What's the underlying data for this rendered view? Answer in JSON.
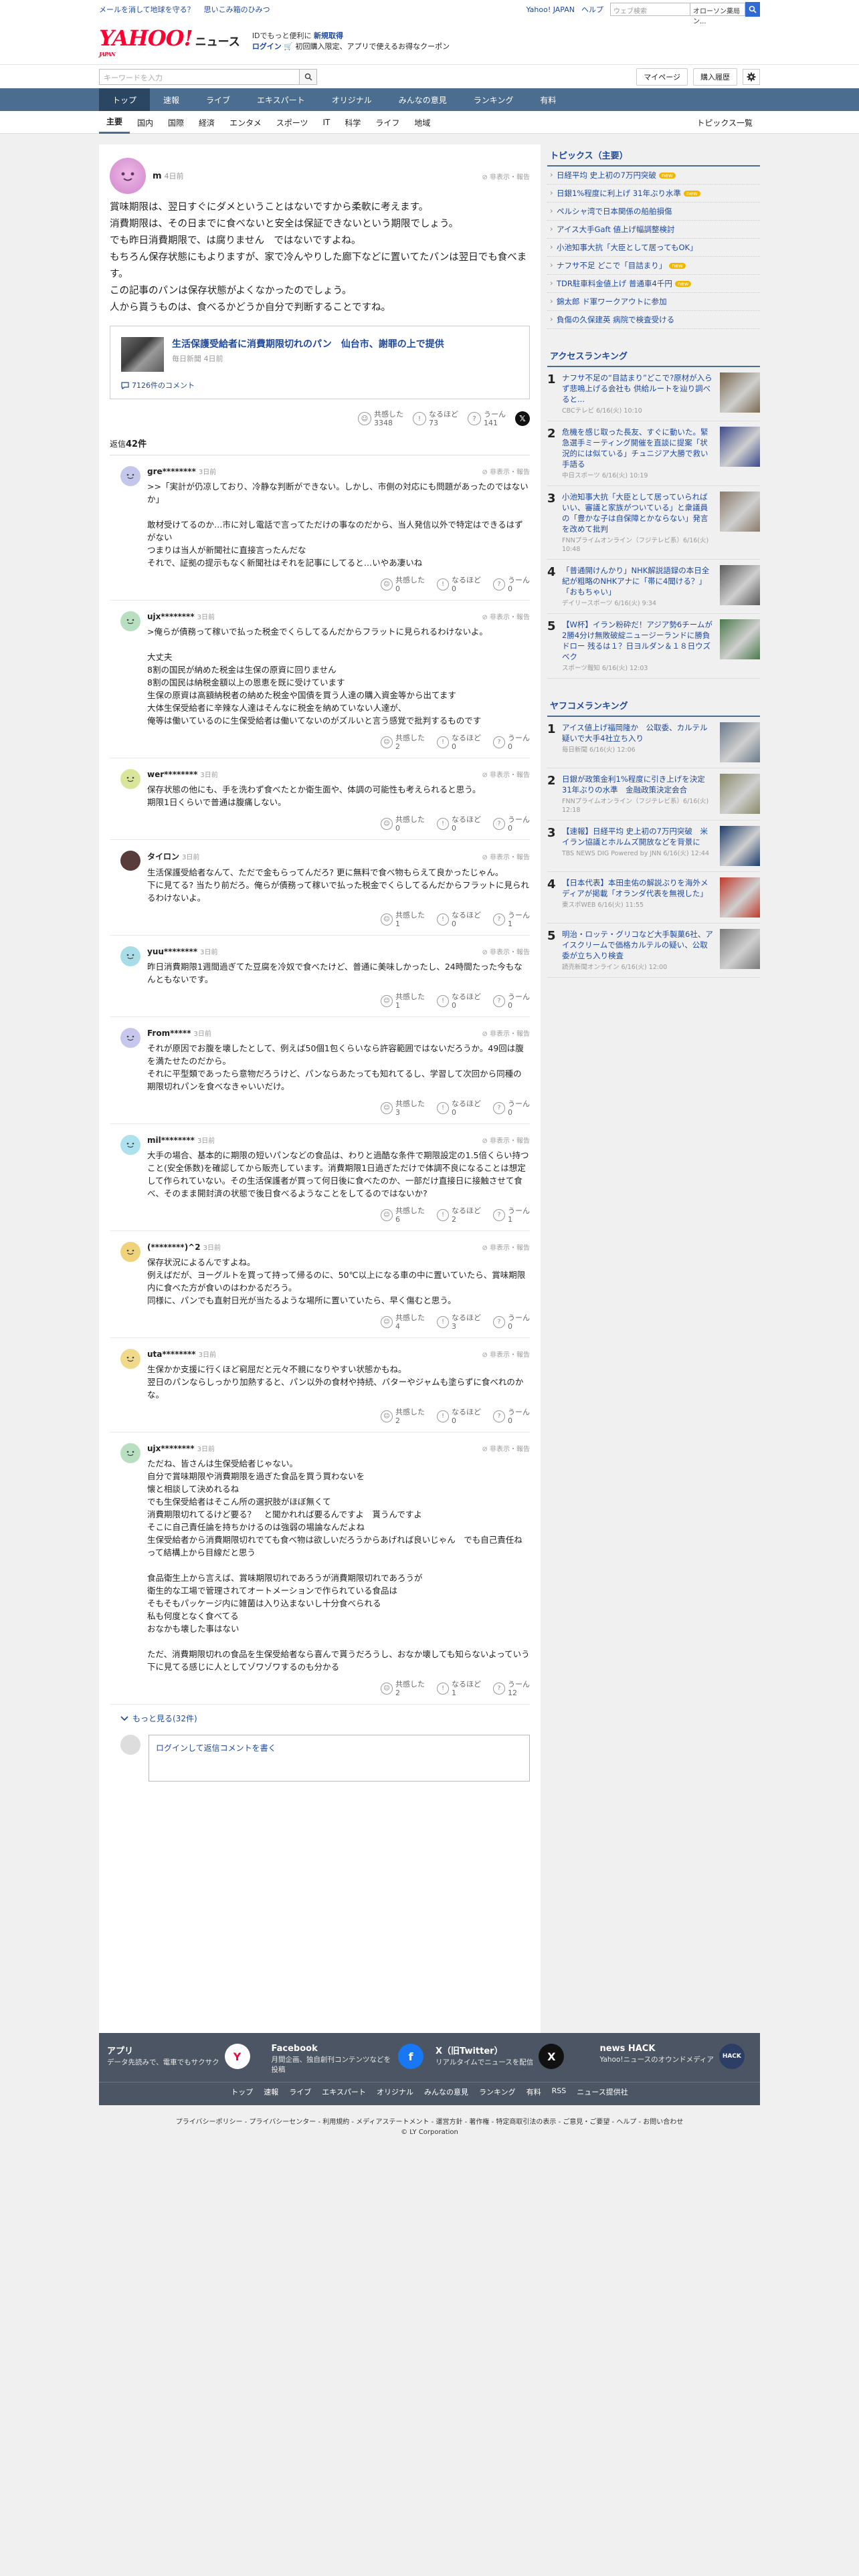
{
  "topbar": {
    "promo1": "メールを消して地球を守る？",
    "promo2": "思いこみ箱のひみつ",
    "links": [
      "Yahoo! JAPAN",
      "ヘルプ"
    ],
    "search_placeholder": "ウェブ検索",
    "search_scope": "オローソン薬局ン..."
  },
  "header": {
    "logo": "YAHOO!",
    "logo_sub": "JAPAN",
    "logo_section": "ニュース",
    "msg_line1_a": "IDでもっと便利に",
    "msg_line1_b": "新規取得",
    "msg_line2_login": "ログイン",
    "msg_line2_rest": "🛒 初回購入限定、アプリで使えるお得なクーポン"
  },
  "searchbar": {
    "placeholder": "キーワードを入力",
    "mypage": "マイページ",
    "history": "購入履歴"
  },
  "nav": {
    "items": [
      "トップ",
      "速報",
      "ライブ",
      "エキスパート",
      "オリジナル",
      "みんなの意見",
      "ランキング",
      "有料"
    ]
  },
  "subnav": {
    "items": [
      "主要",
      "国内",
      "国際",
      "経済",
      "エンタメ",
      "スポーツ",
      "IT",
      "科学",
      "ライフ",
      "地域"
    ],
    "more": "トピックス一覧"
  },
  "op": {
    "name": "m",
    "time": "4日前",
    "report": "非表示・報告",
    "body": [
      "賞味期限は、翌日すぐにダメということはないですから柔軟に考えます。",
      "消費期限は、その日までに食べないと安全は保証できないという期限でしょう。",
      "でも昨日消費期限で、は腐りません　ではないですよね。",
      "もちろん保存状態にもよりますが、家で冷んやりした廊下などに置いてたパンは翌日でも食べます。",
      "この記事のパンは保存状態がよくなかったのでしょう。",
      "人から貰うものは、食べるかどうか自分で判断することですね。"
    ]
  },
  "article": {
    "title": "生活保護受給者に消費期限切れのパン　仙台市、謝罪の上で提供",
    "source": "毎日新聞",
    "time": "4日前",
    "comments": "7126件のコメント"
  },
  "op_reactions": {
    "agree_label": "共感した",
    "agree": "3348",
    "hmm_label": "なるほど",
    "hmm": "73",
    "doubt_label": "うーん",
    "doubt": "141"
  },
  "replies_label": "返信",
  "replies_count": "42件",
  "reaction_labels": {
    "agree": "共感した",
    "hmm": "なるほど",
    "doubt": "うーん"
  },
  "report_label": "非表示・報告",
  "replies": [
    {
      "name": "gre********",
      "time": "3日前",
      "avatar_color": "#c5c7ea",
      "text": ">>「実計が仍凉しており、冷静な判断ができない。しかし、市側の対応にも問題があったのではないか」\n\n敢材受けてるのか…市に対し電話で言ってただけの事なのだから、当人発信以外で特定はできるはずがない\nつまりは当人が新聞社に直接言ったんだな\nそれで、証拠の提示もなく新聞社はそれを記事にしてると…いやあ凄いね",
      "agree": "0",
      "hmm": "0",
      "doubt": "0"
    },
    {
      "name": "ujx********",
      "time": "3日前",
      "avatar_color": "#b8e0c0",
      "text": ">俺らが債務って稼いで払った税金でくらしてるんだからフラットに見られるわけないよ。\n\n大丈夫\n8割の国民が納めた税金は生保の原資に回りません\n8割の国民は納税金額以上の恩恵を既に受けています\n生保の原資は高額納税者の納めた税金や国債を買う人達の購入資金等から出てます\n大体生保受給者に辛辣な人達はそんなに税金を納めていない人達が、\n俺等は働いているのに生保受給者は働いてないのがズルいと言う感覚で批判するものです",
      "agree": "2",
      "hmm": "0",
      "doubt": "0"
    },
    {
      "name": "wer********",
      "time": "3日前",
      "avatar_color": "#d9e69a",
      "text": "保存状態の他にも、手を洗わず食べたとか衛生面や、体調の可能性も考えられると思う。\n期限1日くらいで普通は腹痛しない。",
      "agree": "0",
      "hmm": "0",
      "doubt": "0"
    },
    {
      "name": "タイロン",
      "time": "3日前",
      "avatar_color": "#5a3b3b",
      "text": "生活保護受給者なんて、ただで金もらってんだろ? 更に無料で食べ物もらえて良かったじゃん。\n下に見てる? 当たり前だろ。俺らが債務って稼いで払った税金でくらしてるんだからフラットに見られるわけないよ。",
      "agree": "1",
      "hmm": "0",
      "doubt": "1"
    },
    {
      "name": "yuu********",
      "time": "3日前",
      "avatar_color": "#a8dde8",
      "text": "昨日消費期限1週間過ぎてた豆腐を冷奴で食べたけど、普通に美味しかったし、24時間たった今もなんともないです。",
      "agree": "1",
      "hmm": "0",
      "doubt": "0"
    },
    {
      "name": "From*****",
      "time": "3日前",
      "avatar_color": "#c7c7ee",
      "text": "それが原因でお腹を壊したとして、例えば50個1包くらいなら許容範囲ではないだろうか。49回は腹を満たせたのだから。\nそれに平型類であったら意物だろうけど、パンならあたっても知れてるし、学習して次回から同種の期限切れパンを食べなきゃいいだけ。",
      "agree": "3",
      "hmm": "0",
      "doubt": "0"
    },
    {
      "name": "mil********",
      "time": "3日前",
      "avatar_color": "#aee1f0",
      "text": "大手の場合、基本的に期限の短いパンなどの食品は、わりと過酷な条件で期限設定の1.5倍くらい持つこと(安全係数)を確認してから販売しています。消費期限1日過ぎただけで体調不良になることは想定して作られていない。その生活保護者が買って何日後に食べたのか、一部だけ直接日に接触させて食べ、そのまま開封済の状態で後日食べるようなことをしてるのではないか?",
      "agree": "6",
      "hmm": "2",
      "doubt": "1"
    },
    {
      "name": "(********)^2",
      "time": "3日前",
      "avatar_color": "#f0d27a",
      "text": "保存状況によるんですよね。\n例えばだが、ヨーグルトを買って持って帰るのに、50℃以上になる車の中に置いていたら、賞味期限内に食べた方が食いのはわかるだろう。\n同様に、パンでも直射日光が当たるような場所に置いていたら、早く傷むと思う。",
      "agree": "4",
      "hmm": "3",
      "doubt": "0"
    },
    {
      "name": "uta********",
      "time": "3日前",
      "avatar_color": "#f0d98a",
      "text": "生保かか支援に行くほど窮屈だと元々不親になりやすい状態かもね。\n翌日のパンならしっかり加熱すると、パン以外の食材や持続、バターやジャムも塗らずに食べれのかな。",
      "agree": "2",
      "hmm": "0",
      "doubt": "0"
    },
    {
      "name": "ujx********",
      "time": "3日前",
      "avatar_color": "#b8e0c0",
      "text": "ただね、皆さんは生保受給者じゃない。\n自分で賞味期限や消費期限を過ぎた食品を買う買わないを\n懐と相談して決めれるね\nでも生保受給者はそこん所の選択肢がほぼ無くて\n消費期限切れてるけど要る？　と聞かれれば要るんですよ　貰うんですよ\nそこに自己責任論を持ちかけるのは強弱の場論なんだよね\n生保受給者から消費期限切れでても食べ物は欲しいだろうからあげれば良いじゃん　でも自己責任ね\nって結構上から目線だと思う\n\n食品衛生上から言えば、賞味期限切れであろうが消費期限切れであろうが\n衛生的な工場で管理されてオートメーションで作られている食品は\nそもそもパッケージ内に雑菌は入り込まないし十分食べられる\n私も何度となく食べてる\nおなかも壊した事はない\n\nただ、消費期限切れの食品を生保受給者なら喜んで貰うだろうし、おなか壊しても知らないよっていう\n下に見てる感じに人としてゾワゾワするのも分かる",
      "agree": "2",
      "hmm": "1",
      "doubt": "12"
    }
  ],
  "more_replies": "もっと見る(32件)",
  "reply_form": {
    "login": "ログイン",
    "rest": "して返信コメントを書く"
  },
  "sidebar": {
    "topics_title": "トピックス（主要）",
    "topics": [
      {
        "text": "日経平均 史上初の7万円突破",
        "badge": "new",
        "badge2": ""
      },
      {
        "text": "日銀1%程度に利上げ 31年ぶり水準",
        "badge": "new",
        "badge2": ""
      },
      {
        "text": "ペルシャ湾で日本関係の船舶損傷",
        "badge": "",
        "badge2": ""
      },
      {
        "text": "アイス大手Gaft 値上げ幅調整検討",
        "badge": "",
        "badge2": ""
      },
      {
        "text": "小池知事大抗「大臣として居ってもOK」",
        "badge": "",
        "badge2": ""
      },
      {
        "text": "ナフサ不足 どこで「目詰まり」",
        "badge": "new",
        "badge2": ""
      },
      {
        "text": "TDR駐車料金値上げ 普通車4千円",
        "badge": "new",
        "badge2": ""
      },
      {
        "text": "錦太郎 ド軍ワークアウトに参加",
        "badge": "",
        "badge2": ""
      },
      {
        "text": "負傷の久保建英 病院で検査受ける",
        "badge": "",
        "badge2": ""
      }
    ],
    "access_title": "アクセスランキング",
    "access": [
      {
        "num": "1",
        "title": "ナフサ不足の“目詰まり”どこで?原材が入らず悲鳴上げる会社も 供給ルートを辿り調べると...",
        "meta": "CBCテレビ 6/16(火) 10:10",
        "pic": "#7a6a50"
      },
      {
        "num": "2",
        "title": "危機を感じ取った長友、すぐに動いた。緊急選手ミーティング開催を直談に提案「状況的には似ている」チュニジア大勝で救い手語る",
        "meta": "中日スポーツ 6/16(火) 10:19",
        "pic": "#3b4a8a"
      },
      {
        "num": "3",
        "title": "小池知事大抗「大臣として居っていらればいい、審議と家族がついている」と衆議員の「豊かな子は自保障とかならない」発言を改めて批判",
        "meta": "FNNプライムオンライン（フジテレビ系）6/16(火) 10:48",
        "pic": "#8a7a6a"
      },
      {
        "num": "4",
        "title": "「普通開けんかり」NHK解説語録の本日全紀が粗略のNHKアナに「帯に4聞ける？」「おもちゃい」",
        "meta": "デイリースポーツ 6/16(火) 9:34",
        "pic": "#5a5a5a"
      },
      {
        "num": "5",
        "title": "【W杯】イラン粉砕だ！アジア勢6チームが2勝4分け無敗破綻ニュージーランドに勝負ドロー 残るは１？日ヨルダン＆１８日ウズベク",
        "meta": "スポーツ報知 6/16(火) 12:03",
        "pic": "#4a7a4a"
      }
    ],
    "yahoo_title": "ヤフコメランキング",
    "yahoo": [
      {
        "num": "1",
        "title": "アイス値上げ福岡隆か　公取委、カルテル疑いで大手4社立ち入り",
        "meta": "毎日新聞 6/16(火) 12:06",
        "pic": "#6a7a8a"
      },
      {
        "num": "2",
        "title": "日銀が政策金利1%程度に引き上げを決定 31年ぶりの水準　金融政策決定会合",
        "meta": "FNNプライムオンライン（フジテレビ系）6/16(火) 12:18",
        "pic": "#8a8a6a"
      },
      {
        "num": "3",
        "title": "【速報】日経平均 史上初の7万円突破　米イラン協議とホルムズ開放などを背景に",
        "meta": "TBS NEWS DIG Powered by JNN 6/16(火) 12:44",
        "pic": "#1a3a6a"
      },
      {
        "num": "4",
        "title": "【日本代表】本田圭佑の解説ぶりを海外メディアが掲載「オランダ代表を無視した」",
        "meta": "東スポWEB 6/16(火) 11:55",
        "pic": "#c0392b"
      },
      {
        "num": "5",
        "title": "明治・ロッテ・グリコなど大手製菓6社、アイスクリームで価格カルテルの疑い、公取委が立ち入り検査",
        "meta": "読売新聞オンライン 6/16(火) 12:00",
        "pic": "#7a7a7a"
      }
    ]
  },
  "footer": {
    "promos": [
      {
        "title": "アプリ",
        "desc": "データ先読みで、電車でもサクサク",
        "icon": "Y",
        "color": "#ffffff",
        "fg": "#ff0033"
      },
      {
        "title": "Facebook",
        "desc": "月間企画、独自創刊コンテンツなどを投稿",
        "icon": "f",
        "color": "#1877f2",
        "fg": "#ffffff"
      },
      {
        "title": "X（旧Twitter）",
        "desc": "リアルタイムでニュースを配信",
        "icon": "X",
        "color": "#111111",
        "fg": "#ffffff"
      },
      {
        "title": "news HACK",
        "desc": "Yahoo!ニュースのオウンドメディア",
        "icon": "HACK",
        "color": "#2c3e66",
        "fg": "#ffffff"
      }
    ],
    "nav": [
      "トップ",
      "速報",
      "ライブ",
      "エキスパート",
      "オリジナル",
      "みんなの意見",
      "ランキング",
      "有料",
      "RSS",
      "ニュース提供社"
    ],
    "legal": "プライバシーポリシー - プライバシーセンター - 利用規約 - メディアステートメント - 運営方針 - 著作権 - 特定商取引法の表示 - ご意見・ご要望 - ヘルプ - お問い合わせ",
    "copyright": "© LY Corporation"
  }
}
